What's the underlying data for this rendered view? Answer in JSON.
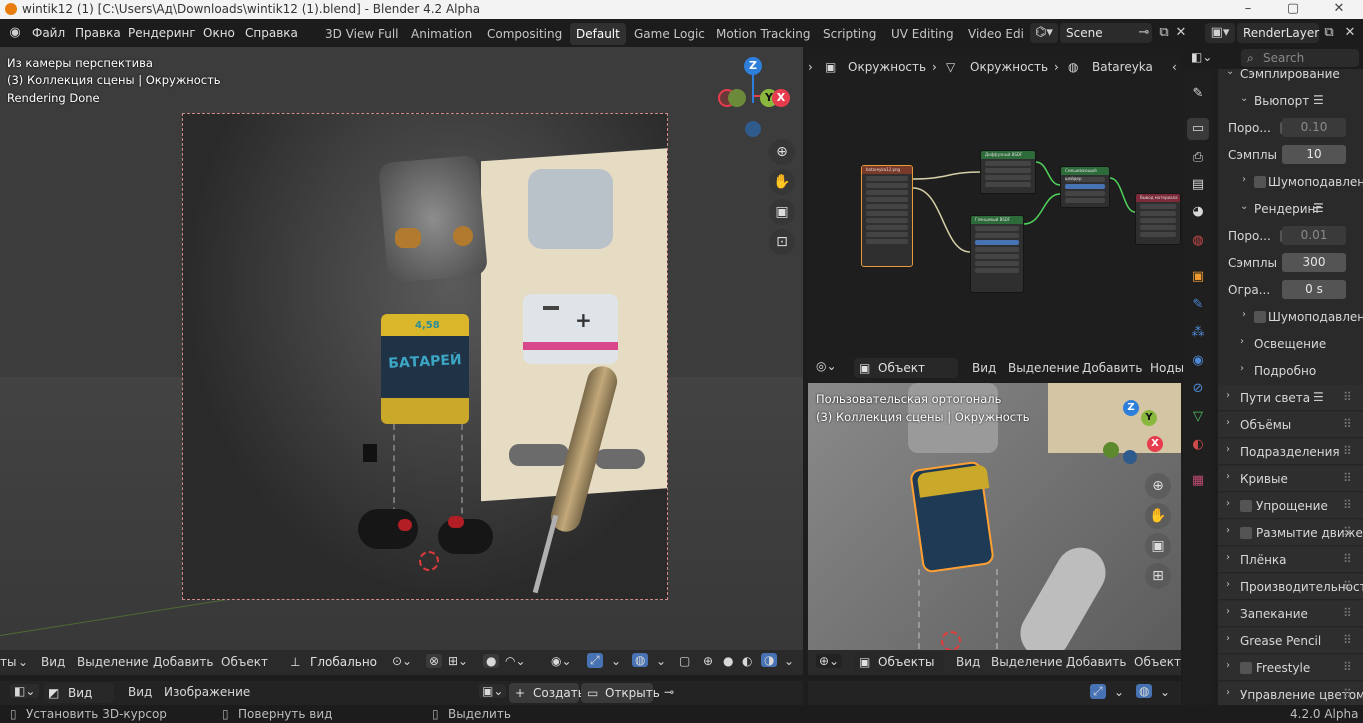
{
  "window": {
    "title": "wintik12 (1) [C:\\Users\\Ад\\Downloads\\wintik12 (1).blend] - Blender 4.2 Alpha",
    "min": "–",
    "max": "▢",
    "close": "✕"
  },
  "menu": [
    "Файл",
    "Правка",
    "Рендеринг",
    "Окно",
    "Справка"
  ],
  "workspaces": [
    "3D View Full",
    "Animation",
    "Compositing",
    "Default",
    "Game Logic",
    "Motion Tracking",
    "Scripting",
    "UV Editing",
    "Video Edi"
  ],
  "active_workspace": "Default",
  "scene": "Scene",
  "render_layer": "RenderLayer",
  "viewport": {
    "overlay": [
      "Из камеры перспектива",
      "(3) Коллекция сцены | Окружность",
      "Rendering Done"
    ],
    "gizmo_axes": [
      "Z",
      "Y",
      "X"
    ],
    "header": {
      "left": "ты",
      "items": [
        "Вид",
        "Выделение",
        "Добавить",
        "Объект"
      ],
      "transform": "Глобально"
    },
    "render_labels": {
      "sign": "БАТАРЕЙ",
      "voltage": "4,58"
    }
  },
  "image_bar": {
    "view_dd": "Вид",
    "items": [
      "Вид",
      "Изображение"
    ],
    "create": "Создать",
    "open": "Открыть"
  },
  "node_editor": {
    "breadcrumb": [
      "Окружность",
      "Окружность",
      "Batareyka"
    ],
    "header": {
      "mode": "Объект",
      "items": [
        "Вид",
        "Выделение",
        "Добавить",
        "Ноды"
      ]
    },
    "node_titles": [
      "batareyka12.png",
      "Диффузный BSDF",
      "Глянцевый BSDF",
      "Смешивающий шейдер",
      "Вывод материала"
    ]
  },
  "viewport2": {
    "overlay": [
      "Пользовательская ортогональ",
      "(3) Коллекция сцены | Окружность"
    ],
    "header": {
      "mode": "Объекты",
      "items": [
        "Вид",
        "Выделение",
        "Добавить",
        "Объект"
      ]
    }
  },
  "properties": {
    "search_placeholder": "Search",
    "rows": [
      {
        "label": "Сэмплирование",
        "indent": 1,
        "open": true
      },
      {
        "label": "Вьюпорт",
        "indent": 2,
        "open": true,
        "list": true
      },
      {
        "label": "Поро...",
        "indent": 3,
        "check": true,
        "value": "0.10",
        "dim": true
      },
      {
        "label": "Сэмплы",
        "indent": 3,
        "value": "10"
      },
      {
        "label": "Шумоподавлен",
        "indent": 3,
        "check": true,
        "closed": true
      },
      {
        "label": "Рендеринг",
        "indent": 2,
        "open": true,
        "list": true
      },
      {
        "label": "Поро...",
        "indent": 3,
        "check": true,
        "value": "0.01",
        "dim": true
      },
      {
        "label": "Сэмплы",
        "indent": 3,
        "value": "300"
      },
      {
        "label": "Огра...",
        "indent": 3,
        "value": "0 s"
      },
      {
        "label": "Шумоподавлен",
        "indent": 3,
        "check": true,
        "closed": true
      },
      {
        "label": "Освещение",
        "indent": 2,
        "closed": true
      },
      {
        "label": "Подробно",
        "indent": 2,
        "closed": true
      },
      {
        "label": "Пути света",
        "indent": 1,
        "closed": true,
        "list": true
      },
      {
        "label": "Объёмы",
        "indent": 1,
        "closed": true
      },
      {
        "label": "Подразделения",
        "indent": 1,
        "closed": true
      },
      {
        "label": "Кривые",
        "indent": 1,
        "closed": true
      },
      {
        "label": "Упрощение",
        "indent": 1,
        "closed": true,
        "check": true
      },
      {
        "label": "Размытие движен",
        "indent": 1,
        "closed": true,
        "check": true
      },
      {
        "label": "Плёнка",
        "indent": 1,
        "closed": true
      },
      {
        "label": "Производительност",
        "indent": 1,
        "closed": true
      },
      {
        "label": "Запекание",
        "indent": 1,
        "closed": true
      },
      {
        "label": "Grease Pencil",
        "indent": 1,
        "closed": true
      },
      {
        "label": "Freestyle",
        "indent": 1,
        "closed": true,
        "check": true
      },
      {
        "label": "Управление цветом",
        "indent": 1,
        "closed": true
      }
    ]
  },
  "status": {
    "items": [
      "Установить 3D-курсор",
      "Повернуть вид",
      "Выделить"
    ],
    "version": "4.2.0 Alpha"
  },
  "colors": {
    "accent": "#4772b3",
    "select": "#ffa033",
    "x_axis": "#e63c4d",
    "y_axis": "#8ab83f",
    "z_axis": "#2e7fd9"
  }
}
